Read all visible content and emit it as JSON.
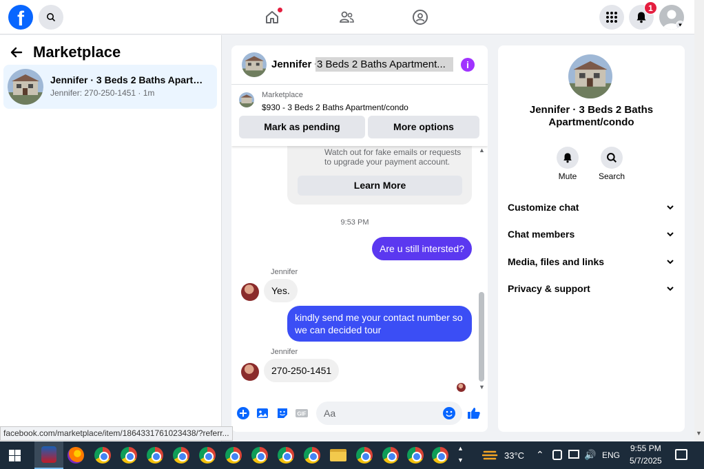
{
  "topbar": {
    "logo": "f",
    "notifications_badge": "1"
  },
  "left_panel": {
    "title": "Marketplace",
    "conversation": {
      "title": "Jennifer · 3 Beds 2 Baths Apartme...",
      "subtitle": "Jennifer: 270-250-1451 · 1m"
    }
  },
  "chat": {
    "header_name": "Jennifer ·",
    "header_title": "3 Beds 2 Baths Apartment...",
    "listing_label": "Marketplace",
    "listing_title": "$930 - 3 Beds 2 Baths Apartment/condo",
    "mark_pending": "Mark as pending",
    "more_options": "More options",
    "warning_text": "Watch out for fake emails or requests to upgrade your payment account.",
    "learn_more": "Learn More",
    "timestamp": "9:53 PM",
    "messages": [
      {
        "text": "Are u still intersted?"
      },
      {
        "sender": "Jennifer",
        "text": "Yes."
      },
      {
        "text": "kindly send me your contact number so we can decided tour"
      },
      {
        "sender": "Jennifer",
        "text": "270-250-1451"
      }
    ],
    "composer_placeholder": "Aa"
  },
  "right_panel": {
    "title": "Jennifer · 3 Beds 2 Baths Apartment/condo",
    "mute_label": "Mute",
    "search_label": "Search",
    "sections": [
      "Customize chat",
      "Chat members",
      "Media, files and links",
      "Privacy & support"
    ]
  },
  "status_url": "facebook.com/marketplace/item/1864331761023438/?referr...",
  "taskbar": {
    "temperature": "33°C",
    "language": "ENG",
    "time": "9:55 PM",
    "date": "5/7/2025"
  },
  "colors": {
    "brand": "#0866ff",
    "outgoing_bubble": "#5b38f0",
    "accent_purple": "#a033ff"
  }
}
